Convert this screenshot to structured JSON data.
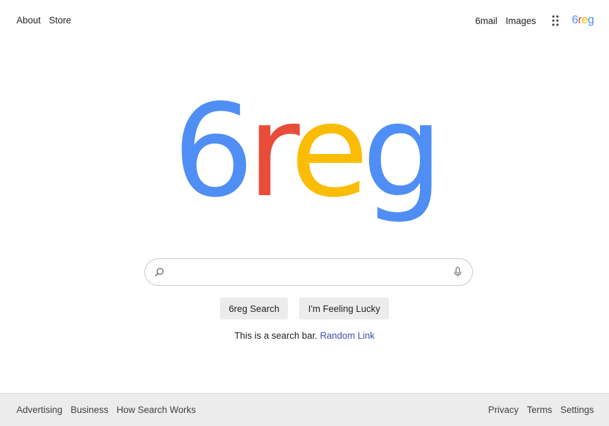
{
  "header": {
    "left_links": [
      "About",
      "Store"
    ],
    "right_links": [
      "6mail",
      "Images"
    ],
    "apps_icon": "grid-dots-icon",
    "mini_logo": [
      "6",
      "r",
      "e",
      "g"
    ]
  },
  "logo": {
    "letters": [
      "6",
      "r",
      "e",
      "g"
    ],
    "colors": [
      "#4f8ef5",
      "#ea4c3a",
      "#fbbc05",
      "#4f8ef5"
    ]
  },
  "search": {
    "value": "",
    "placeholder": "",
    "search_icon": "search-icon",
    "mic_icon": "microphone-icon"
  },
  "buttons": {
    "search_label": "6reg Search",
    "lucky_label": "I'm Feeling Lucky"
  },
  "info": {
    "text": "This is a search bar.",
    "link_text": "Random Link"
  },
  "footer": {
    "left_links": [
      "Advertising",
      "Business",
      "How Search Works"
    ],
    "right_links": [
      "Privacy",
      "Terms",
      "Settings"
    ]
  }
}
